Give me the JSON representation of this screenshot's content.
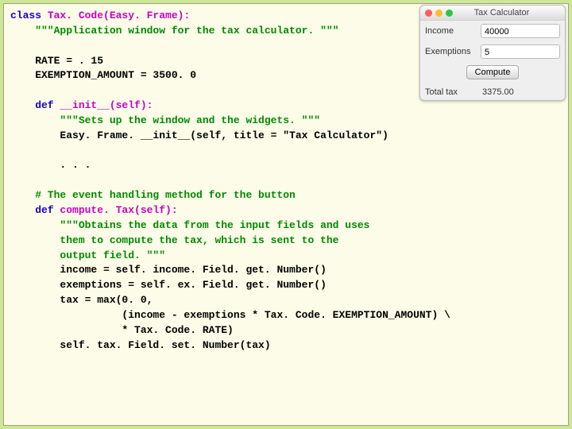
{
  "code": {
    "line01a": "class ",
    "line01b": "Tax. Code(Easy. Frame):",
    "line02": "    \"\"\"Application window for the tax calculator. \"\"\"",
    "line03": "",
    "line04": "    RATE = . 15",
    "line05": "    EXEMPTION_AMOUNT = 3500. 0",
    "line06": "",
    "line07a": "    def ",
    "line07b": "__init__(self):",
    "line08": "        \"\"\"Sets up the window and the widgets. \"\"\"",
    "line09": "        Easy. Frame. __init__(self, title = \"Tax Calculator\")",
    "line10": "",
    "line11": "        . . .",
    "line12": "",
    "line13": "    # The event handling method for the button",
    "line14a": "    def ",
    "line14b": "compute. Tax(self):",
    "line15": "        \"\"\"Obtains the data from the input fields and uses",
    "line16": "        them to compute the tax, which is sent to the",
    "line17": "        output field. \"\"\"",
    "line18": "        income = self. income. Field. get. Number()",
    "line19": "        exemptions = self. ex. Field. get. Number()",
    "line20": "        tax = max(0. 0,",
    "line21": "                  (income - exemptions * Tax. Code. EXEMPTION_AMOUNT) \\",
    "line22": "                  * Tax. Code. RATE)",
    "line23": "        self. tax. Field. set. Number(tax)"
  },
  "app": {
    "title": "Tax Calculator",
    "rows": {
      "income_label": "Income",
      "income_value": "40000",
      "exempt_label": "Exemptions",
      "exempt_value": "5",
      "total_label": "Total tax",
      "total_value": "3375.00"
    },
    "button": "Compute"
  }
}
